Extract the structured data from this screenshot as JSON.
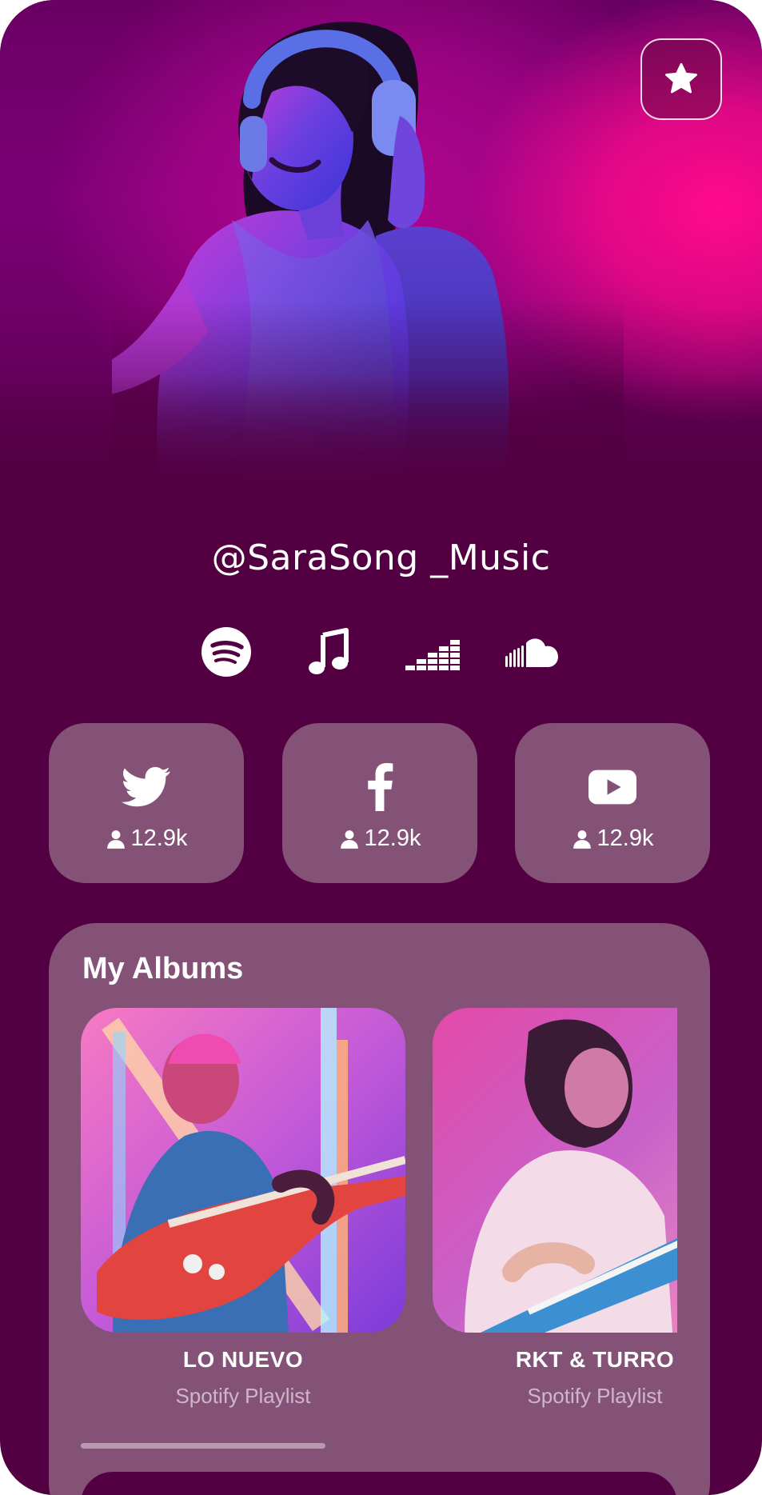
{
  "profile": {
    "handle": "@SaraSong _Music"
  },
  "platforms": [
    {
      "name": "spotify-icon"
    },
    {
      "name": "music-note-icon"
    },
    {
      "name": "deezer-icon"
    },
    {
      "name": "soundcloud-icon"
    }
  ],
  "socials": [
    {
      "icon": "twitter-icon",
      "count": "12.9k"
    },
    {
      "icon": "facebook-icon",
      "count": "12.9k"
    },
    {
      "icon": "youtube-icon",
      "count": "12.9k"
    }
  ],
  "albums": {
    "title": "My Albums",
    "items": [
      {
        "name": "LO NUEVO",
        "subtitle": "Spotify Playlist"
      },
      {
        "name": "RKT & TURRO",
        "subtitle": "Spotify Playlist"
      }
    ]
  },
  "colors": {
    "background": "#520041",
    "card": "#855277",
    "accent_pink": "#ff0a8c"
  }
}
